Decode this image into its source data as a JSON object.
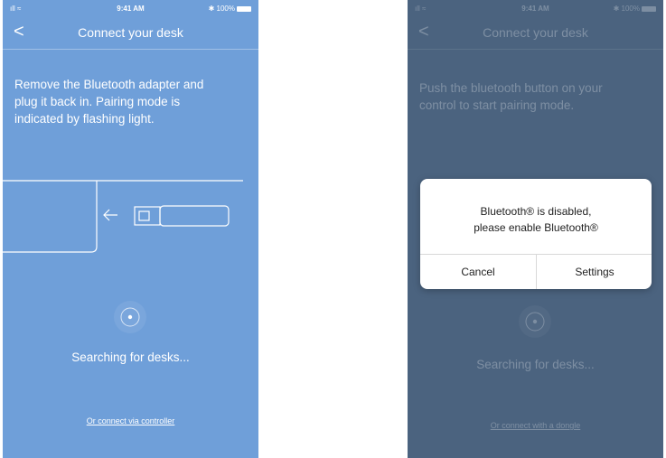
{
  "left_screen": {
    "status": {
      "signal": "ıll ≈",
      "time": "9:41 AM",
      "battery": "✱ 100%"
    },
    "nav": {
      "back_glyph": "<",
      "title": "Connect your desk"
    },
    "instructions": "Remove the Bluetooth adapter and plug it back in. Pairing mode is indicated by flashing light.",
    "searching_text": "Searching for desks...",
    "alt_link": "Or connect via controller",
    "illustration_icons": [
      "usb-dongle-icon",
      "arrow-left-icon",
      "desk-port-icon"
    ],
    "spinner_icon": "searching-target-icon"
  },
  "right_screen": {
    "status": {
      "signal": "ıll ≈",
      "time": "9:41 AM",
      "battery": "✱ 100%"
    },
    "nav": {
      "back_glyph": "<",
      "title": "Connect your desk"
    },
    "instructions": "Push the bluetooth button on your control to start pairing mode.",
    "searching_text": "Searching for desks...",
    "alt_link": "Or connect with a dongle",
    "dialog": {
      "line1": "Bluetooth® is disabled,",
      "line2": "please enable Bluetooth®",
      "cancel_label": "Cancel",
      "settings_label": "Settings"
    }
  },
  "colors": {
    "left_background": "#6f9fd9",
    "right_background": "#4b637f",
    "dialog_background": "#ffffff"
  }
}
